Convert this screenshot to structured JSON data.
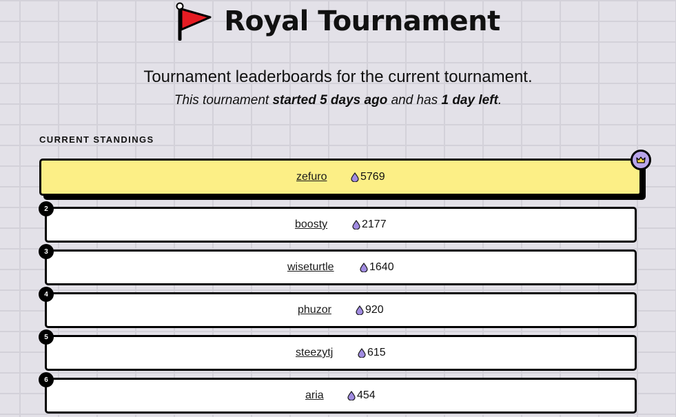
{
  "header": {
    "title": "Royal Tournament",
    "flag_color": "#e51c23"
  },
  "intro": {
    "subtitle": "Tournament leaderboards for the current tournament.",
    "line_prefix": "This tournament ",
    "line_started": "started 5 days ago",
    "line_middle": " and has ",
    "line_left": "1 day left",
    "line_suffix": "."
  },
  "standings": {
    "label": "CURRENT STANDINGS",
    "leader_highlight_color": "#fcef86",
    "drop_color": "#a08be0",
    "crown_badge_icon": "crown-icon",
    "entries": [
      {
        "rank": "1",
        "name": "zefuro",
        "score": "5769"
      },
      {
        "rank": "2",
        "name": "boosty",
        "score": "2177"
      },
      {
        "rank": "3",
        "name": "wiseturtle",
        "score": "1640"
      },
      {
        "rank": "4",
        "name": "phuzor",
        "score": "920"
      },
      {
        "rank": "5",
        "name": "steezytj",
        "score": "615"
      },
      {
        "rank": "6",
        "name": "aria",
        "score": "454"
      }
    ]
  }
}
